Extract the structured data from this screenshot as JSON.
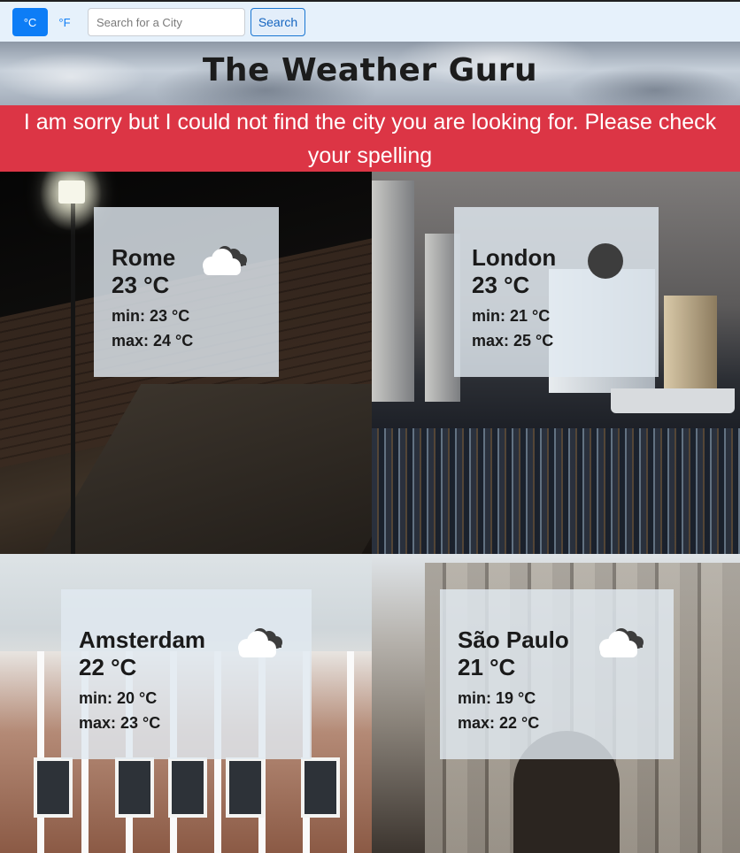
{
  "toolbar": {
    "celsius_label": "°C",
    "fahrenheit_label": "°F",
    "search_placeholder": "Search for a City",
    "search_value": "",
    "search_button_label": "Search",
    "accent_color": "#0d7df6"
  },
  "header": {
    "title": "The Weather Guru"
  },
  "error": {
    "message": "I am sorry but I could not find the city you are looking for. Please check your spelling",
    "color": "#dc3545"
  },
  "cities": [
    {
      "name": "Rome",
      "temp": "23 °C",
      "min": "min: 23 °C",
      "max": "max: 24 °C",
      "icon": "cloudy-icon"
    },
    {
      "name": "London",
      "temp": "23 °C",
      "min": "min: 21 °C",
      "max": "max: 25 °C",
      "icon": "moon-icon"
    },
    {
      "name": "Amsterdam",
      "temp": "22 °C",
      "min": "min: 20 °C",
      "max": "max: 23 °C",
      "icon": "cloudy-icon"
    },
    {
      "name": "São Paulo",
      "temp": "21 °C",
      "min": "min: 19 °C",
      "max": "max: 22 °C",
      "icon": "cloudy-icon"
    }
  ]
}
